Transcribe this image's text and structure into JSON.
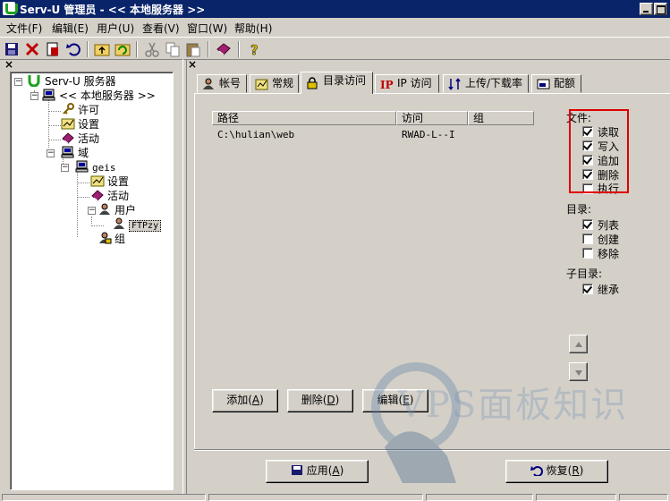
{
  "window": {
    "title": "Serv-U 管理员 - << 本地服务器 >>"
  },
  "menu": [
    "文件(F)",
    "编辑(E)",
    "用户(U)",
    "查看(V)",
    "窗口(W)",
    "帮助(H)"
  ],
  "tree": {
    "close_glyph": "×",
    "root": "Serv-U 服务器",
    "server": "<< 本地服务器 >>",
    "license": "许可",
    "settings": "设置",
    "activity": "活动",
    "domains": "域",
    "domain": "geis",
    "domain_settings": "设置",
    "domain_activity": "活动",
    "users": "用户",
    "user": "FTPzy",
    "groups": "组",
    "expander_minus": "−"
  },
  "right_close_glyph": "×",
  "tabs": [
    "帐号",
    "常规",
    "目录访问",
    "IP 访问",
    "上传/下载率",
    "配额"
  ],
  "active_tab_index": 2,
  "list": {
    "columns": [
      "路径",
      "访问",
      "组"
    ],
    "rows": [
      {
        "path": "C:\\hulian\\web",
        "access": "RWAD-L--I",
        "group": ""
      }
    ]
  },
  "permissions": {
    "files_label": "文件:",
    "files": [
      {
        "label": "读取",
        "checked": true
      },
      {
        "label": "写入",
        "checked": true
      },
      {
        "label": "追加",
        "checked": true
      },
      {
        "label": "删除",
        "checked": true
      },
      {
        "label": "执行",
        "checked": false
      }
    ],
    "dirs_label": "目录:",
    "dirs": [
      {
        "label": "列表",
        "checked": true
      },
      {
        "label": "创建",
        "checked": false
      },
      {
        "label": "移除",
        "checked": false
      }
    ],
    "subdirs_label": "子目录:",
    "subdirs": [
      {
        "label": "继承",
        "checked": true
      }
    ]
  },
  "buttons": {
    "add": "添加(A)",
    "add_key": "A",
    "delete": "删除(D)",
    "delete_key": "D",
    "edit": "编辑(E)",
    "edit_key": "E",
    "apply": "应用(A)",
    "apply_key": "A",
    "restore": "恢复(R)",
    "restore_key": "R"
  },
  "watermark": "VPS面板知识",
  "colors": {
    "titlebar": "#0a246a",
    "highlight": "#e00000",
    "face": "#d4d0c8"
  }
}
